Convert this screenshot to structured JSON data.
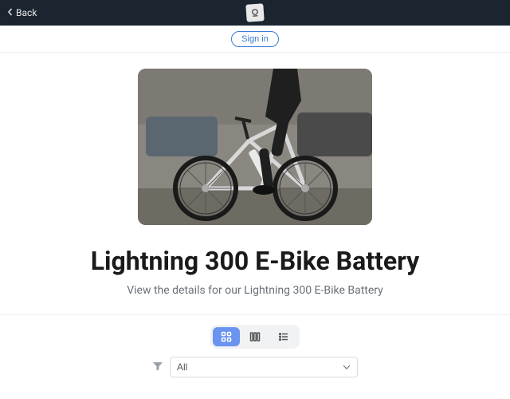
{
  "topbar": {
    "back_label": "Back"
  },
  "auth": {
    "signin_label": "Sign in"
  },
  "hero": {
    "title": "Lightning 300 E-Bike Battery",
    "subtitle": "View the details for our Lightning 300 E-Bike Battery"
  },
  "controls": {
    "filter_selected": "All"
  }
}
